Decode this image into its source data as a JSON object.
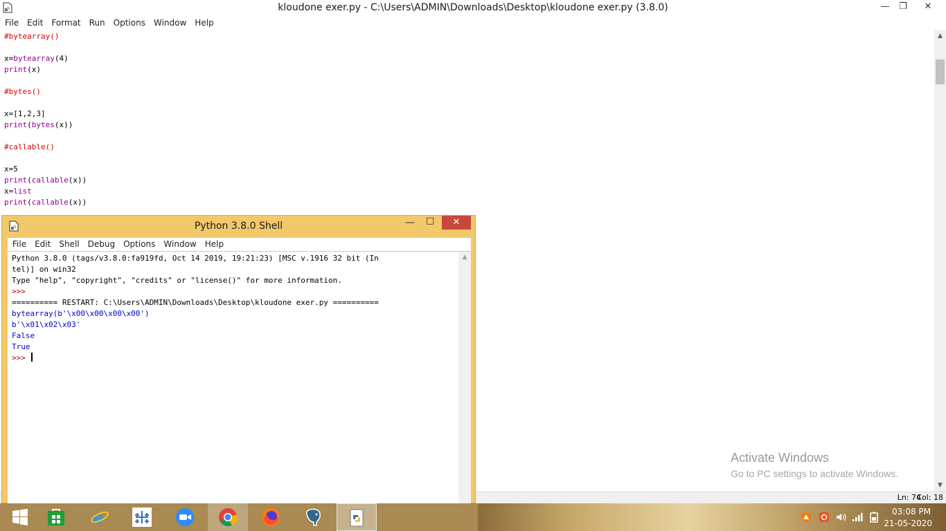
{
  "editor": {
    "title": "kloudone exer.py - C:\\Users\\ADMIN\\Downloads\\Desktop\\kloudone exer.py (3.8.0)",
    "menu": [
      "File",
      "Edit",
      "Format",
      "Run",
      "Options",
      "Window",
      "Help"
    ],
    "lines": [
      {
        "text": "#bytearray()",
        "kind": "comment"
      },
      {
        "text": "",
        "kind": "plain"
      },
      {
        "text": "x=bytearray(4)",
        "kind": "mixed"
      },
      {
        "text": "print(x)",
        "kind": "mixed"
      },
      {
        "text": "",
        "kind": "plain"
      },
      {
        "text": "#bytes()",
        "kind": "comment"
      },
      {
        "text": "",
        "kind": "plain"
      },
      {
        "text": "x=[1,2,3]",
        "kind": "plain"
      },
      {
        "text": "print(bytes(x))",
        "kind": "mixed"
      },
      {
        "text": "",
        "kind": "plain"
      },
      {
        "text": "#callable()",
        "kind": "comment"
      },
      {
        "text": "",
        "kind": "plain"
      },
      {
        "text": "x=5",
        "kind": "plain"
      },
      {
        "text": "print(callable(x))",
        "kind": "mixed"
      },
      {
        "text": "x=list",
        "kind": "mixed"
      },
      {
        "text": "print(callable(x))",
        "kind": "mixed"
      }
    ],
    "status": {
      "ln": "Ln: 74",
      "col": "Col: 18"
    }
  },
  "shell": {
    "title": "Python 3.8.0 Shell",
    "menu": [
      "File",
      "Edit",
      "Shell",
      "Debug",
      "Options",
      "Window",
      "Help"
    ],
    "lines": [
      {
        "text": "Python 3.8.0 (tags/v3.8.0:fa919fd, Oct 14 2019, 19:21:23) [MSC v.1916 32 bit (In",
        "kind": "plain"
      },
      {
        "text": "tel)] on win32",
        "kind": "plain"
      },
      {
        "text": "Type \"help\", \"copyright\", \"credits\" or \"license()\" for more information.",
        "kind": "plain"
      },
      {
        "text": ">>> ",
        "kind": "prompt"
      },
      {
        "text": "========== RESTART: C:\\Users\\ADMIN\\Downloads\\Desktop\\kloudone exer.py ==========",
        "kind": "plain"
      },
      {
        "text": "bytearray(b'\\x00\\x00\\x00\\x00')",
        "kind": "output"
      },
      {
        "text": "b'\\x01\\x02\\x03'",
        "kind": "output"
      },
      {
        "text": "False",
        "kind": "output"
      },
      {
        "text": "True",
        "kind": "output"
      },
      {
        "text": ">>> ",
        "kind": "prompt"
      }
    ]
  },
  "watermark": {
    "title": "Activate Windows",
    "subtitle": "Go to PC settings to activate Windows."
  },
  "taskbar": {
    "items": [
      {
        "name": "start",
        "icon": "windows-logo-icon"
      },
      {
        "name": "store",
        "icon": "store-icon"
      },
      {
        "name": "ie",
        "icon": "internet-explorer-icon"
      },
      {
        "name": "tableau",
        "icon": "tableau-icon"
      },
      {
        "name": "zoom",
        "icon": "zoom-icon"
      },
      {
        "name": "chrome",
        "icon": "chrome-icon"
      },
      {
        "name": "firefox",
        "icon": "firefox-icon"
      },
      {
        "name": "postgres",
        "icon": "postgresql-icon"
      },
      {
        "name": "python",
        "icon": "python-idle-icon"
      }
    ],
    "clock": {
      "time": "03:08 PM",
      "date": "21-05-2020"
    }
  },
  "colors": {
    "comment": "#dd0000",
    "builtin": "#900090",
    "output": "#0000cc",
    "prompt": "#a00000",
    "shell_frame": "#f2c86a",
    "close_red": "#c9483c"
  }
}
